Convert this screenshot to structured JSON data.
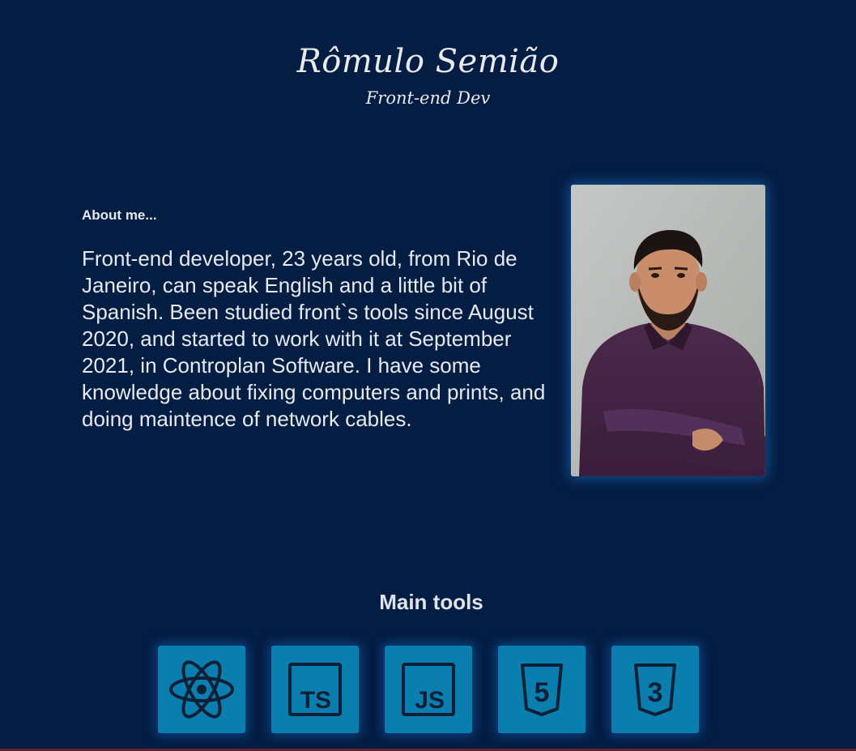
{
  "header": {
    "name": "Rômulo Semião",
    "role": "Front-end Dev"
  },
  "about": {
    "heading": "About me...",
    "text": "Front-end developer, 23 years old, from Rio de Janeiro, can speak English and a little bit of Spanish. Been studied front`s tools since August 2020, and started to work with it at September 2021, in Controplan Software. I have some knowledge about fixing computers and prints, and doing maintence of network cables.",
    "photo": "profile-photo"
  },
  "tools": {
    "heading": "Main tools",
    "items": [
      {
        "name": "React",
        "icon": "react-icon"
      },
      {
        "name": "TypeScript",
        "icon": "typescript-icon",
        "glyph": "TS"
      },
      {
        "name": "JavaScript",
        "icon": "javascript-icon",
        "glyph": "JS"
      },
      {
        "name": "HTML5",
        "icon": "html5-icon",
        "glyph": "5"
      },
      {
        "name": "CSS3",
        "icon": "css3-icon",
        "glyph": "3"
      }
    ]
  },
  "colors": {
    "background": "#041d42",
    "text": "#e6e9ee",
    "tile": "#0b7eb0",
    "icon_stroke": "#0d2036"
  }
}
